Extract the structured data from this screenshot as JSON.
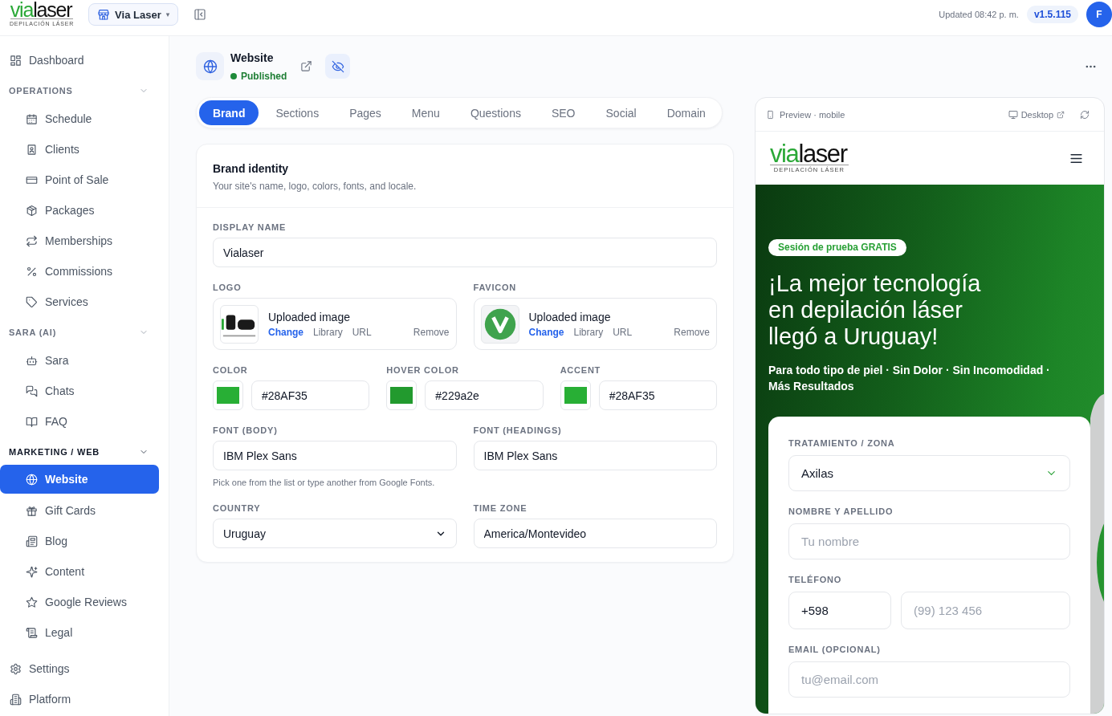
{
  "topbar": {
    "logo": {
      "wordmark_start": "via",
      "wordmark_end": "laser",
      "tagline": "DEPILACIÓN LÁSER"
    },
    "workspace": {
      "label": "Via Laser",
      "caret": "▾"
    },
    "updated": "Updated 08:42 p. m.",
    "version": "v1.5.115",
    "avatar": "F"
  },
  "sidebar": {
    "items": [
      {
        "kind": "link",
        "label": "Dashboard",
        "selected": false
      },
      {
        "kind": "section",
        "label": "OPERATIONS",
        "expanded": true,
        "children": [
          {
            "label": "Schedule",
            "selected": false
          },
          {
            "label": "Clients",
            "selected": false
          },
          {
            "label": "Point of Sale",
            "selected": false
          },
          {
            "label": "Packages",
            "selected": false
          },
          {
            "label": "Memberships",
            "selected": false
          },
          {
            "label": "Commissions",
            "selected": false
          },
          {
            "label": "Services",
            "selected": false
          }
        ]
      },
      {
        "kind": "section",
        "label": "SARA (AI)",
        "expanded": true,
        "children": [
          {
            "label": "Sara",
            "selected": false
          },
          {
            "label": "Chats",
            "selected": false
          },
          {
            "label": "FAQ",
            "selected": false
          }
        ]
      },
      {
        "kind": "section",
        "label": "MARKETING / WEB",
        "expanded": true,
        "children": [
          {
            "label": "Website",
            "selected": true
          },
          {
            "label": "Gift Cards",
            "selected": false
          },
          {
            "label": "Blog",
            "selected": false
          },
          {
            "label": "Content",
            "selected": false
          },
          {
            "label": "Google Reviews",
            "selected": false
          },
          {
            "label": "Legal",
            "selected": false
          }
        ]
      },
      {
        "kind": "link",
        "label": "Settings",
        "selected": false
      },
      {
        "kind": "link",
        "label": "Platform",
        "selected": false
      }
    ]
  },
  "page_header": {
    "title": "Website",
    "status": "Published"
  },
  "tabs": [
    {
      "label": "Brand",
      "selected": true
    },
    {
      "label": "Sections",
      "selected": false
    },
    {
      "label": "Pages",
      "selected": false
    },
    {
      "label": "Menu",
      "selected": false
    },
    {
      "label": "Questions",
      "selected": false
    },
    {
      "label": "SEO",
      "selected": false
    },
    {
      "label": "Social",
      "selected": false
    },
    {
      "label": "Domain",
      "selected": false
    }
  ],
  "brand_card": {
    "title": "Brand identity",
    "description": "Your site's name, logo, colors, fonts, and locale.",
    "display_name": {
      "label": "DISPLAY NAME",
      "value": "Vialaser"
    },
    "uploads": [
      {
        "kind": "logo",
        "label": "LOGO",
        "status": "Uploaded image",
        "actions": [
          {
            "label": "Change",
            "kind": "primary"
          },
          {
            "label": "Library",
            "kind": "plain"
          },
          {
            "label": "URL",
            "kind": "plain"
          }
        ],
        "remove": "Remove"
      },
      {
        "kind": "favicon",
        "label": "FAVICON",
        "status": "Uploaded image",
        "actions": [
          {
            "label": "Change",
            "kind": "primary"
          },
          {
            "label": "Library",
            "kind": "plain"
          },
          {
            "label": "URL",
            "kind": "plain"
          }
        ],
        "remove": "Remove"
      }
    ],
    "colors": [
      {
        "label": "COLOR",
        "value": "#28AF35",
        "color": "#28af35"
      },
      {
        "label": "HOVER COLOR",
        "value": "#229a2e",
        "color": "#229a2e"
      },
      {
        "label": "ACCENT",
        "value": "#28AF35",
        "color": "#28af35"
      }
    ],
    "fonts": [
      {
        "label": "FONT (BODY)",
        "value": "IBM Plex Sans"
      },
      {
        "label": "FONT (HEADINGS)",
        "value": "IBM Plex Sans"
      }
    ],
    "font_hint": "Pick one from the list or type another from Google Fonts.",
    "locale": [
      {
        "kind": "select",
        "label": "COUNTRY",
        "value": "Uruguay"
      },
      {
        "kind": "text",
        "label": "TIME ZONE",
        "value": "America/Montevideo"
      }
    ]
  },
  "preview": {
    "title": "Preview · mobile",
    "desktop": "Desktop",
    "site": {
      "logo": {
        "wordmark_start": "via",
        "wordmark_end": "laser",
        "tagline": "DEPILACIÓN LÁSER"
      },
      "hero": {
        "badge": "Sesión de prueba GRATIS",
        "heading": "¡La mejor tecnología en depilación láser llegó a Uruguay!",
        "subheading": "Para todo tipo de piel · Sin Dolor · Sin Incomodidad · Más Resultados"
      },
      "form": {
        "fields": [
          {
            "kind": "select",
            "label": "TRATAMIENTO / ZONA",
            "value": "Axilas"
          },
          {
            "kind": "text",
            "label": "NOMBRE Y APELLIDO",
            "placeholder": "Tu nombre"
          },
          {
            "kind": "phone",
            "label": "TELÉFONO",
            "value": "+598",
            "placeholder": "(99) 123 456"
          },
          {
            "kind": "text",
            "label": "EMAIL (OPCIONAL)",
            "placeholder": "tu@email.com"
          }
        ]
      }
    }
  }
}
